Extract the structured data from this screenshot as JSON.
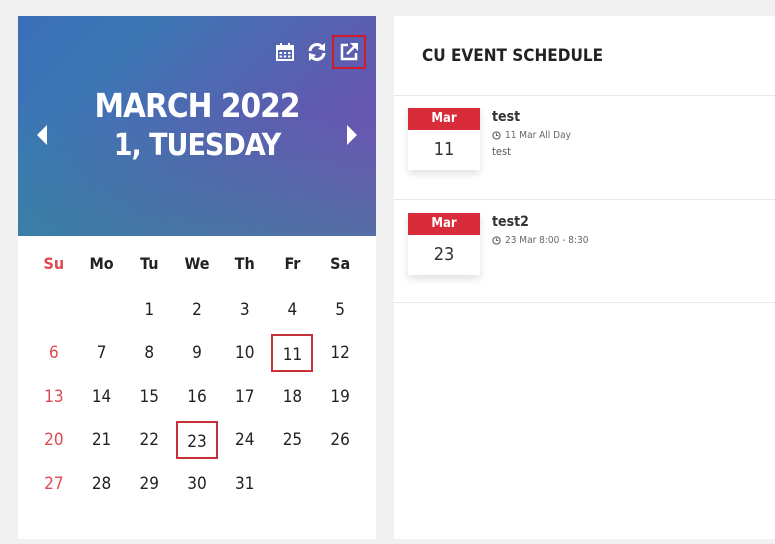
{
  "calendar": {
    "header": {
      "title_line1": "MARCH 2022",
      "title_line2": "1, TUESDAY",
      "icons": [
        "calendar-icon",
        "refresh-icon",
        "external-link-icon"
      ],
      "prev_icon": "chevron-left-icon",
      "next_icon": "chevron-right-icon",
      "gradient_colors": [
        "#3a6fb8",
        "#7a4bb2",
        "#2a9a98"
      ]
    },
    "weekdays": [
      "Su",
      "Mo",
      "Tu",
      "We",
      "Th",
      "Fr",
      "Sa"
    ],
    "weeks": [
      [
        "",
        "",
        "1",
        "2",
        "3",
        "4",
        "5"
      ],
      [
        "6",
        "7",
        "8",
        "9",
        "10",
        "11",
        "12"
      ],
      [
        "13",
        "14",
        "15",
        "16",
        "17",
        "18",
        "19"
      ],
      [
        "20",
        "21",
        "22",
        "23",
        "24",
        "25",
        "26"
      ],
      [
        "27",
        "28",
        "29",
        "30",
        "31",
        "",
        ""
      ]
    ],
    "event_days": [
      "11",
      "23"
    ],
    "sunday_color": "#e04a52",
    "marker_color": "#c8303a"
  },
  "schedule": {
    "title": "CU EVENT SCHEDULE",
    "events": [
      {
        "month": "Mar",
        "day": "11",
        "title": "test",
        "time": "11 Mar All Day",
        "description": "test"
      },
      {
        "month": "Mar",
        "day": "23",
        "title": "test2",
        "time": "23 Mar 8:00 - 8:30",
        "description": ""
      }
    ],
    "accent_color": "#d92c3a"
  }
}
